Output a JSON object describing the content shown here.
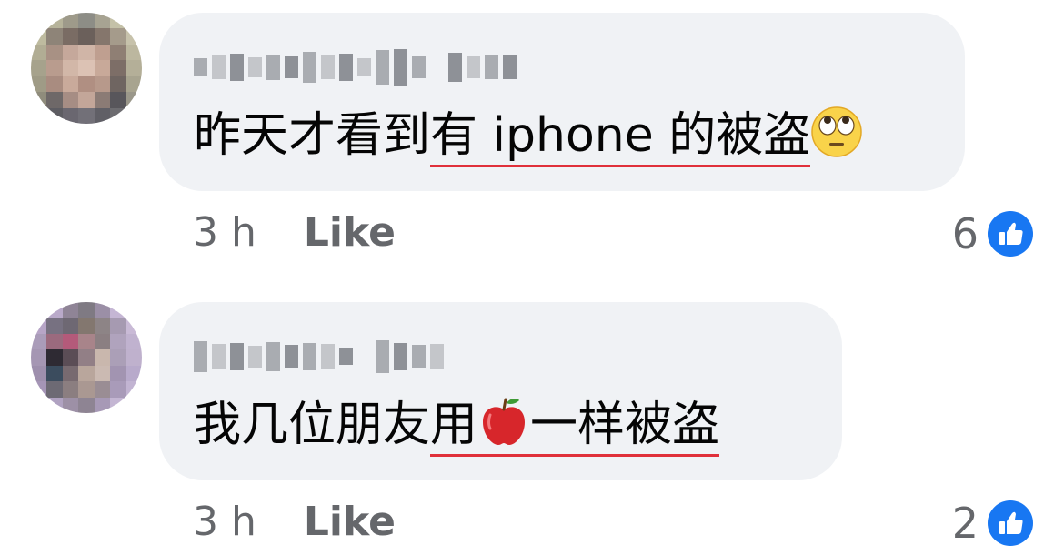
{
  "comments": [
    {
      "author": "Yuan-Feng Lee",
      "text_plain": "昨天才看到",
      "text_marked": "有 iphone 的被盗",
      "emoji": "face-with-rolling-eyes",
      "time": "3 h",
      "like_label": "Like",
      "reaction_count": "6"
    },
    {
      "author": "Hiew Tan",
      "text_plain": "我几位朋友",
      "text_marked_a": "用",
      "emoji": "red-apple",
      "text_marked_b": "一样被盗",
      "time": "3 h",
      "like_label": "Like",
      "reaction_count": "2"
    }
  ],
  "colors": {
    "bubble": "#f0f2f5",
    "text": "#050505",
    "secondary": "#65676b",
    "like_badge": "#1877f2",
    "underline": "#e0303a"
  }
}
